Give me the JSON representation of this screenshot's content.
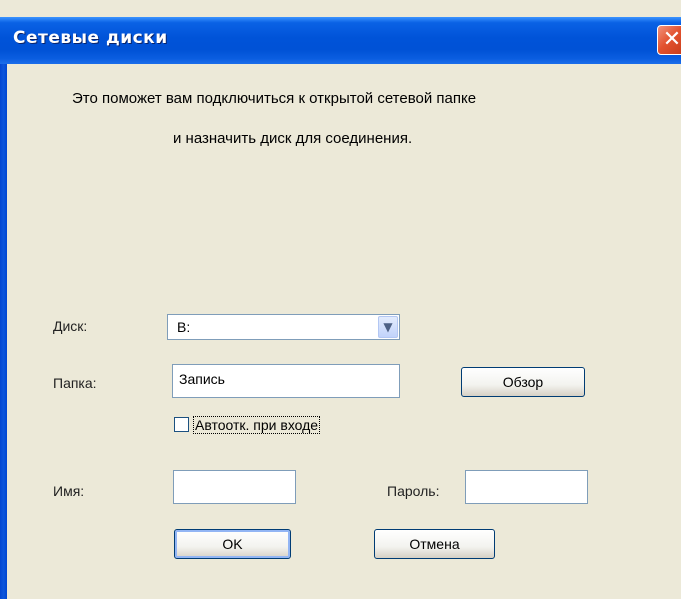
{
  "window": {
    "title": "Сетевые диски",
    "close_symbol": "✕"
  },
  "intro": {
    "line1": "Это поможет вам подключиться к открытой сетевой папке",
    "line2": "и назначить диск для соединения."
  },
  "drive": {
    "label": "Диск:",
    "selected": "B:",
    "arrow_icon": "chevron-down-icon"
  },
  "folder": {
    "label": "Папка:",
    "value": "Запись",
    "browse_label": "Обзор"
  },
  "autodisconnect": {
    "label": "Автоотк. при входе",
    "checked": false
  },
  "credentials": {
    "name_label": "Имя:",
    "name_value": "",
    "password_label": "Пароль:",
    "password_value": ""
  },
  "buttons": {
    "ok": "OK",
    "cancel": "Отмена"
  },
  "colors": {
    "titlebar": "#0053d8",
    "close": "#e2522f",
    "dialog_bg": "#ece9d8"
  }
}
